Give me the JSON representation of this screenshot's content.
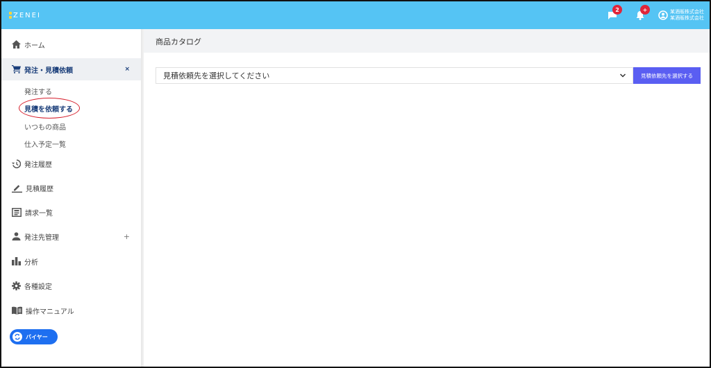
{
  "header": {
    "logo_text": "ZENEI",
    "messages_badge": "2",
    "notifications_badge": "+",
    "account_line1": "某酒販株式会社",
    "account_line2": "某酒販株式会社",
    "bar_color": "#55c4f4"
  },
  "sidebar": {
    "home": "ホーム",
    "order_quote": "発注・見積依頼",
    "order_quote_close": "×",
    "sub_items": [
      "発注する",
      "見積を依頼する",
      "いつもの商品",
      "仕入予定一覧"
    ],
    "order_history": "発注履歴",
    "quote_history": "見積履歴",
    "invoice_list": "請求一覧",
    "supplier_mgmt": "発注先管理",
    "supplier_mgmt_expand": "+",
    "analytics": "分析",
    "settings": "各種設定",
    "manual": "操作マニュアル",
    "buyer_toggle": "バイヤー",
    "active_color": "#1a3e7a"
  },
  "main": {
    "page_title": "商品カタログ",
    "select_placeholder": "見積依頼先を選択してください",
    "select_button": "見積依頼先を選択する",
    "button_color": "#5a5ef2"
  }
}
